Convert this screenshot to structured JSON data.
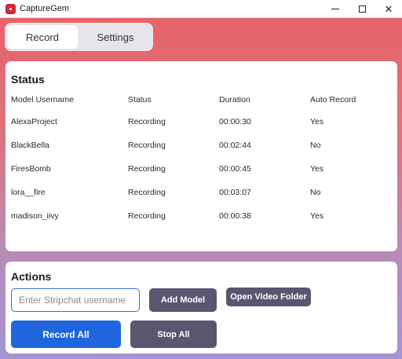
{
  "window": {
    "title": "CaptureGem"
  },
  "tabs": {
    "record": "Record",
    "settings": "Settings"
  },
  "status": {
    "title": "Status",
    "headers": [
      "Model Username",
      "Status",
      "Duration",
      "Auto Record"
    ],
    "rows": [
      [
        "AlexaProject",
        "Recording",
        "00:00:30",
        "Yes"
      ],
      [
        "BlackBella",
        "Recording",
        "00:02:44",
        "No"
      ],
      [
        "FiresBomb",
        "Recording",
        "00:00:45",
        "Yes"
      ],
      [
        "lora__fire",
        "Recording",
        "00:03:07",
        "No"
      ],
      [
        "madison_iivy",
        "Recording",
        "00:00:38",
        "Yes"
      ]
    ]
  },
  "actions": {
    "title": "Actions",
    "username_placeholder": "Enter Stripchat username",
    "add_model": "Add Model",
    "open_folder": "Open Video Folder",
    "record_all": "Record All",
    "stop_all": "Stop All"
  },
  "colors": {
    "accent_blue": "#1f66de",
    "button_dark": "#5a5670",
    "gradient_top": "#e8636a",
    "gradient_bottom": "#a394d4"
  }
}
